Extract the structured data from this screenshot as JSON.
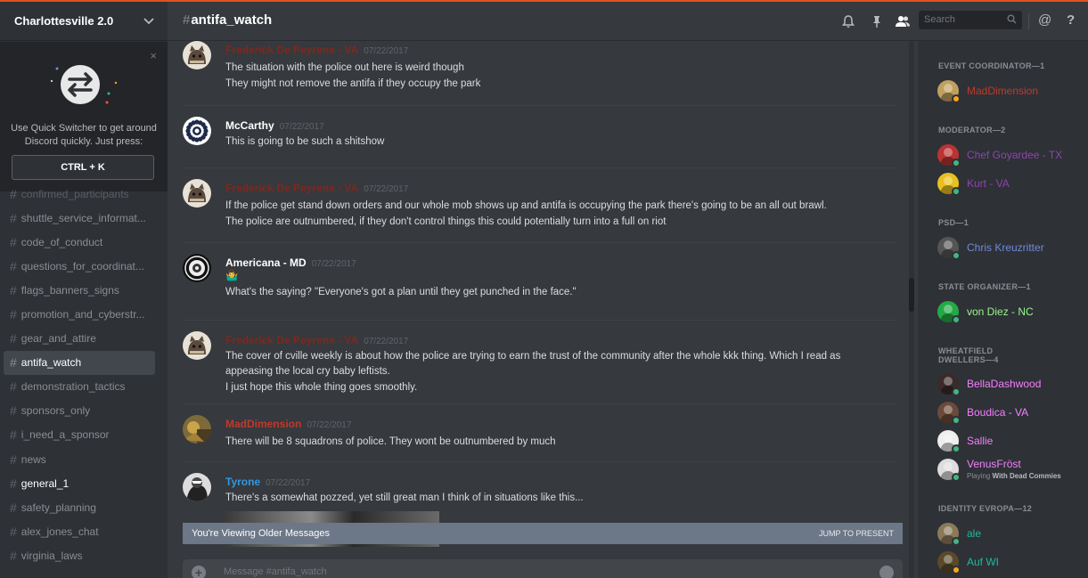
{
  "guild": {
    "name": "Charlottesville 2.0"
  },
  "quick_switcher": {
    "text_line1": "Use Quick Switcher to get around",
    "text_line2": "Discord quickly. Just press:",
    "shortcut": "CTRL + K",
    "close": "×"
  },
  "channels": [
    {
      "name": "confirmed_participants",
      "state": "faded"
    },
    {
      "name": "shuttle_service_informat...",
      "state": "normal"
    },
    {
      "name": "code_of_conduct",
      "state": "normal"
    },
    {
      "name": "questions_for_coordinat...",
      "state": "normal"
    },
    {
      "name": "flags_banners_signs",
      "state": "normal"
    },
    {
      "name": "promotion_and_cyberstr...",
      "state": "normal"
    },
    {
      "name": "gear_and_attire",
      "state": "normal"
    },
    {
      "name": "antifa_watch",
      "state": "active"
    },
    {
      "name": "demonstration_tactics",
      "state": "normal"
    },
    {
      "name": "sponsors_only",
      "state": "normal"
    },
    {
      "name": "i_need_a_sponsor",
      "state": "normal"
    },
    {
      "name": "news",
      "state": "normal"
    },
    {
      "name": "general_1",
      "state": "unread"
    },
    {
      "name": "safety_planning",
      "state": "normal"
    },
    {
      "name": "alex_jones_chat",
      "state": "normal"
    },
    {
      "name": "virginia_laws",
      "state": "normal"
    }
  ],
  "header": {
    "hash": "#",
    "channel": "antifa_watch",
    "search_placeholder": "Search",
    "icons": [
      "bell-icon",
      "pin-icon",
      "members-icon",
      "search-icon",
      "at-icon",
      "help-icon"
    ],
    "at": "@",
    "help": "?"
  },
  "messages": [
    {
      "author": "Frederick De Peyrens - VA",
      "color": "#7a2a1f",
      "time": "07/22/2017",
      "avatar": "fred",
      "lines": [
        "The situation with the police out here is weird though",
        "They might not remove the antifa if they occupy the park"
      ]
    },
    {
      "author": "McCarthy",
      "color": "#ffffff",
      "time": "07/22/2017",
      "avatar": "mccarthy",
      "lines": [
        "This is going to be such a shitshow"
      ]
    },
    {
      "author": "Frederick De Peyrens - VA",
      "color": "#7a2a1f",
      "time": "07/22/2017",
      "avatar": "fred",
      "lines": [
        "If the police get stand down orders and our whole mob shows up and antifa is occupying the park there's going to be an all out brawl.",
        "The police are outnumbered, if they don't control things this could potentially turn into a full on riot"
      ]
    },
    {
      "author": "Americana - MD",
      "color": "#ffffff",
      "time": "07/22/2017",
      "avatar": "americana",
      "lines": [
        "🤷‍♂️",
        "What's the saying? \"Everyone's got a plan until they get punched in the face.\""
      ]
    },
    {
      "author": "Frederick De Peyrens - VA",
      "color": "#7a2a1f",
      "time": "07/22/2017",
      "avatar": "fred",
      "lines": [
        "The cover of cville weekly is about how the police are trying to earn the trust of the community after the whole kkk thing. Which I read as",
        "appeasing the local cry baby leftists.",
        "I just hope this whole thing goes smoothly."
      ]
    },
    {
      "author": "MadDimension",
      "color": "#c0392b",
      "time": "07/22/2017",
      "avatar": "mad",
      "lines": [
        "There will be 8 squadrons of police. They wont be outnumbered by much"
      ]
    },
    {
      "author": "Tyrone",
      "color": "#3498db",
      "time": "07/22/2017",
      "avatar": "tyrone",
      "lines": [
        "There's a somewhat pozzed, yet still great man I think of in situations like this..."
      ]
    }
  ],
  "older_bar": {
    "left": "You're Viewing Older Messages",
    "right": "JUMP TO PRESENT"
  },
  "composer": {
    "placeholder": "Message #antifa_watch"
  },
  "members": {
    "roles": [
      {
        "title": "EVENT COORDINATOR—1",
        "people": [
          {
            "name": "MadDimension",
            "color": "#c0392b",
            "status": "#faa61a"
          }
        ]
      },
      {
        "title": "MODERATOR—2",
        "people": [
          {
            "name": "Chef Goyardee - TX",
            "color": "#8e44ad",
            "status": "#43b581"
          },
          {
            "name": "Kurt - VA",
            "color": "#8e44ad",
            "status": "#43b581"
          }
        ]
      },
      {
        "title": "PSD—1",
        "people": [
          {
            "name": "Chris Kreuzritter",
            "color": "#7289da",
            "status": "#43b581"
          }
        ]
      },
      {
        "title": "STATE ORGANIZER—1",
        "people": [
          {
            "name": "von Diez - NC",
            "color": "#9cf58f",
            "status": "#43b581"
          }
        ]
      },
      {
        "title_lines": [
          "WHEATFIELD",
          "DWELLERS—4"
        ],
        "people": [
          {
            "name": "BellaDashwood",
            "color": "#f47fff",
            "status": "#43b581"
          },
          {
            "name": "Boudica - VA",
            "color": "#f47fff",
            "status": "#43b581"
          },
          {
            "name": "Sallie",
            "color": "#f47fff",
            "status": "#43b581"
          },
          {
            "name": "VenusFröst",
            "color": "#f47fff",
            "status": "#43b581",
            "playing_prefix": "Playing ",
            "playing_game": "With Dead Commies"
          }
        ]
      },
      {
        "title": "IDENTITY EVROPA—12",
        "people": [
          {
            "name": "ale",
            "color": "#1abc9c",
            "status": "#43b581"
          },
          {
            "name": "Auf WI",
            "color": "#1abc9c",
            "status": "#faa61a"
          }
        ]
      }
    ]
  }
}
